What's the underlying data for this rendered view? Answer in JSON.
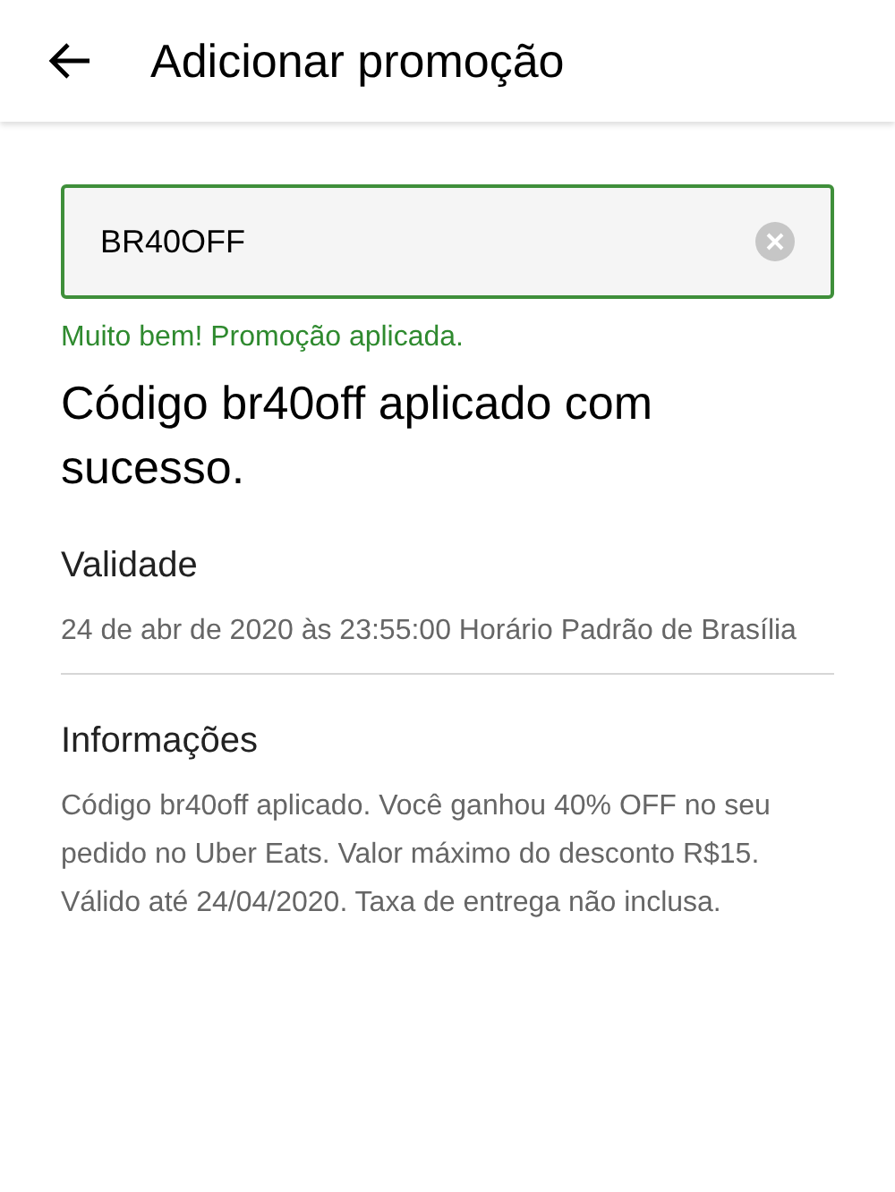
{
  "header": {
    "title": "Adicionar promoção"
  },
  "promo_field": {
    "value": "BR40OFF"
  },
  "success_message": "Muito bem! Promoção aplicada.",
  "heading": "Código br40off aplicado com sucesso.",
  "sections": [
    {
      "title": "Validade",
      "text": "24 de abr de 2020 às 23:55:00 Horário Padrão de Brasília"
    },
    {
      "title": "Informações",
      "text": "Código br40off aplicado. Você ganhou 40% OFF no seu pedido no Uber Eats. Valor máximo do desconto R$15. Válido até 24/04/2020. Taxa de entrega não inclusa."
    }
  ]
}
